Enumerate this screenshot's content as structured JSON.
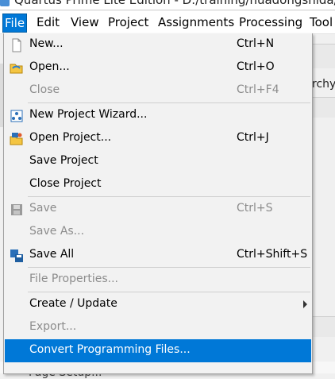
{
  "window": {
    "title": "Quartus Prime Lite Edition - D:/training/huadongshida/remo"
  },
  "menubar": {
    "items": [
      {
        "label": "File",
        "active": true
      },
      {
        "label": "Edit"
      },
      {
        "label": "View"
      },
      {
        "label": "Project"
      },
      {
        "label": "Assignments"
      },
      {
        "label": "Processing"
      },
      {
        "label": "Tool"
      }
    ]
  },
  "background": {
    "fragment_text": "rchy",
    "bottom_fragment": "Page Setup..."
  },
  "file_menu": {
    "items": [
      {
        "label": "New...",
        "shortcut": "Ctrl+N",
        "icon": "new-file-icon",
        "enabled": true
      },
      {
        "label": "Open...",
        "shortcut": "Ctrl+O",
        "icon": "open-folder-icon",
        "enabled": true
      },
      {
        "label": "Close",
        "shortcut": "Ctrl+F4",
        "enabled": false
      },
      {
        "label": "New Project Wizard...",
        "icon": "project-wizard-icon",
        "enabled": true
      },
      {
        "label": "Open Project...",
        "shortcut": "Ctrl+J",
        "icon": "open-project-icon",
        "enabled": true
      },
      {
        "label": "Save Project",
        "enabled": true
      },
      {
        "label": "Close Project",
        "enabled": true
      },
      {
        "label": "Save",
        "shortcut": "Ctrl+S",
        "icon": "save-icon",
        "enabled": false
      },
      {
        "label": "Save As...",
        "enabled": false
      },
      {
        "label": "Save All",
        "shortcut": "Ctrl+Shift+S",
        "icon": "save-all-icon",
        "enabled": true
      },
      {
        "label": "File Properties...",
        "enabled": false
      },
      {
        "label": "Create / Update",
        "submenu": true,
        "enabled": true
      },
      {
        "label": "Export...",
        "enabled": false
      },
      {
        "label": "Convert Programming Files...",
        "enabled": true,
        "highlighted": true
      }
    ]
  },
  "colors": {
    "highlight": "#0078d7",
    "disabled_text": "#8c8c8c"
  }
}
